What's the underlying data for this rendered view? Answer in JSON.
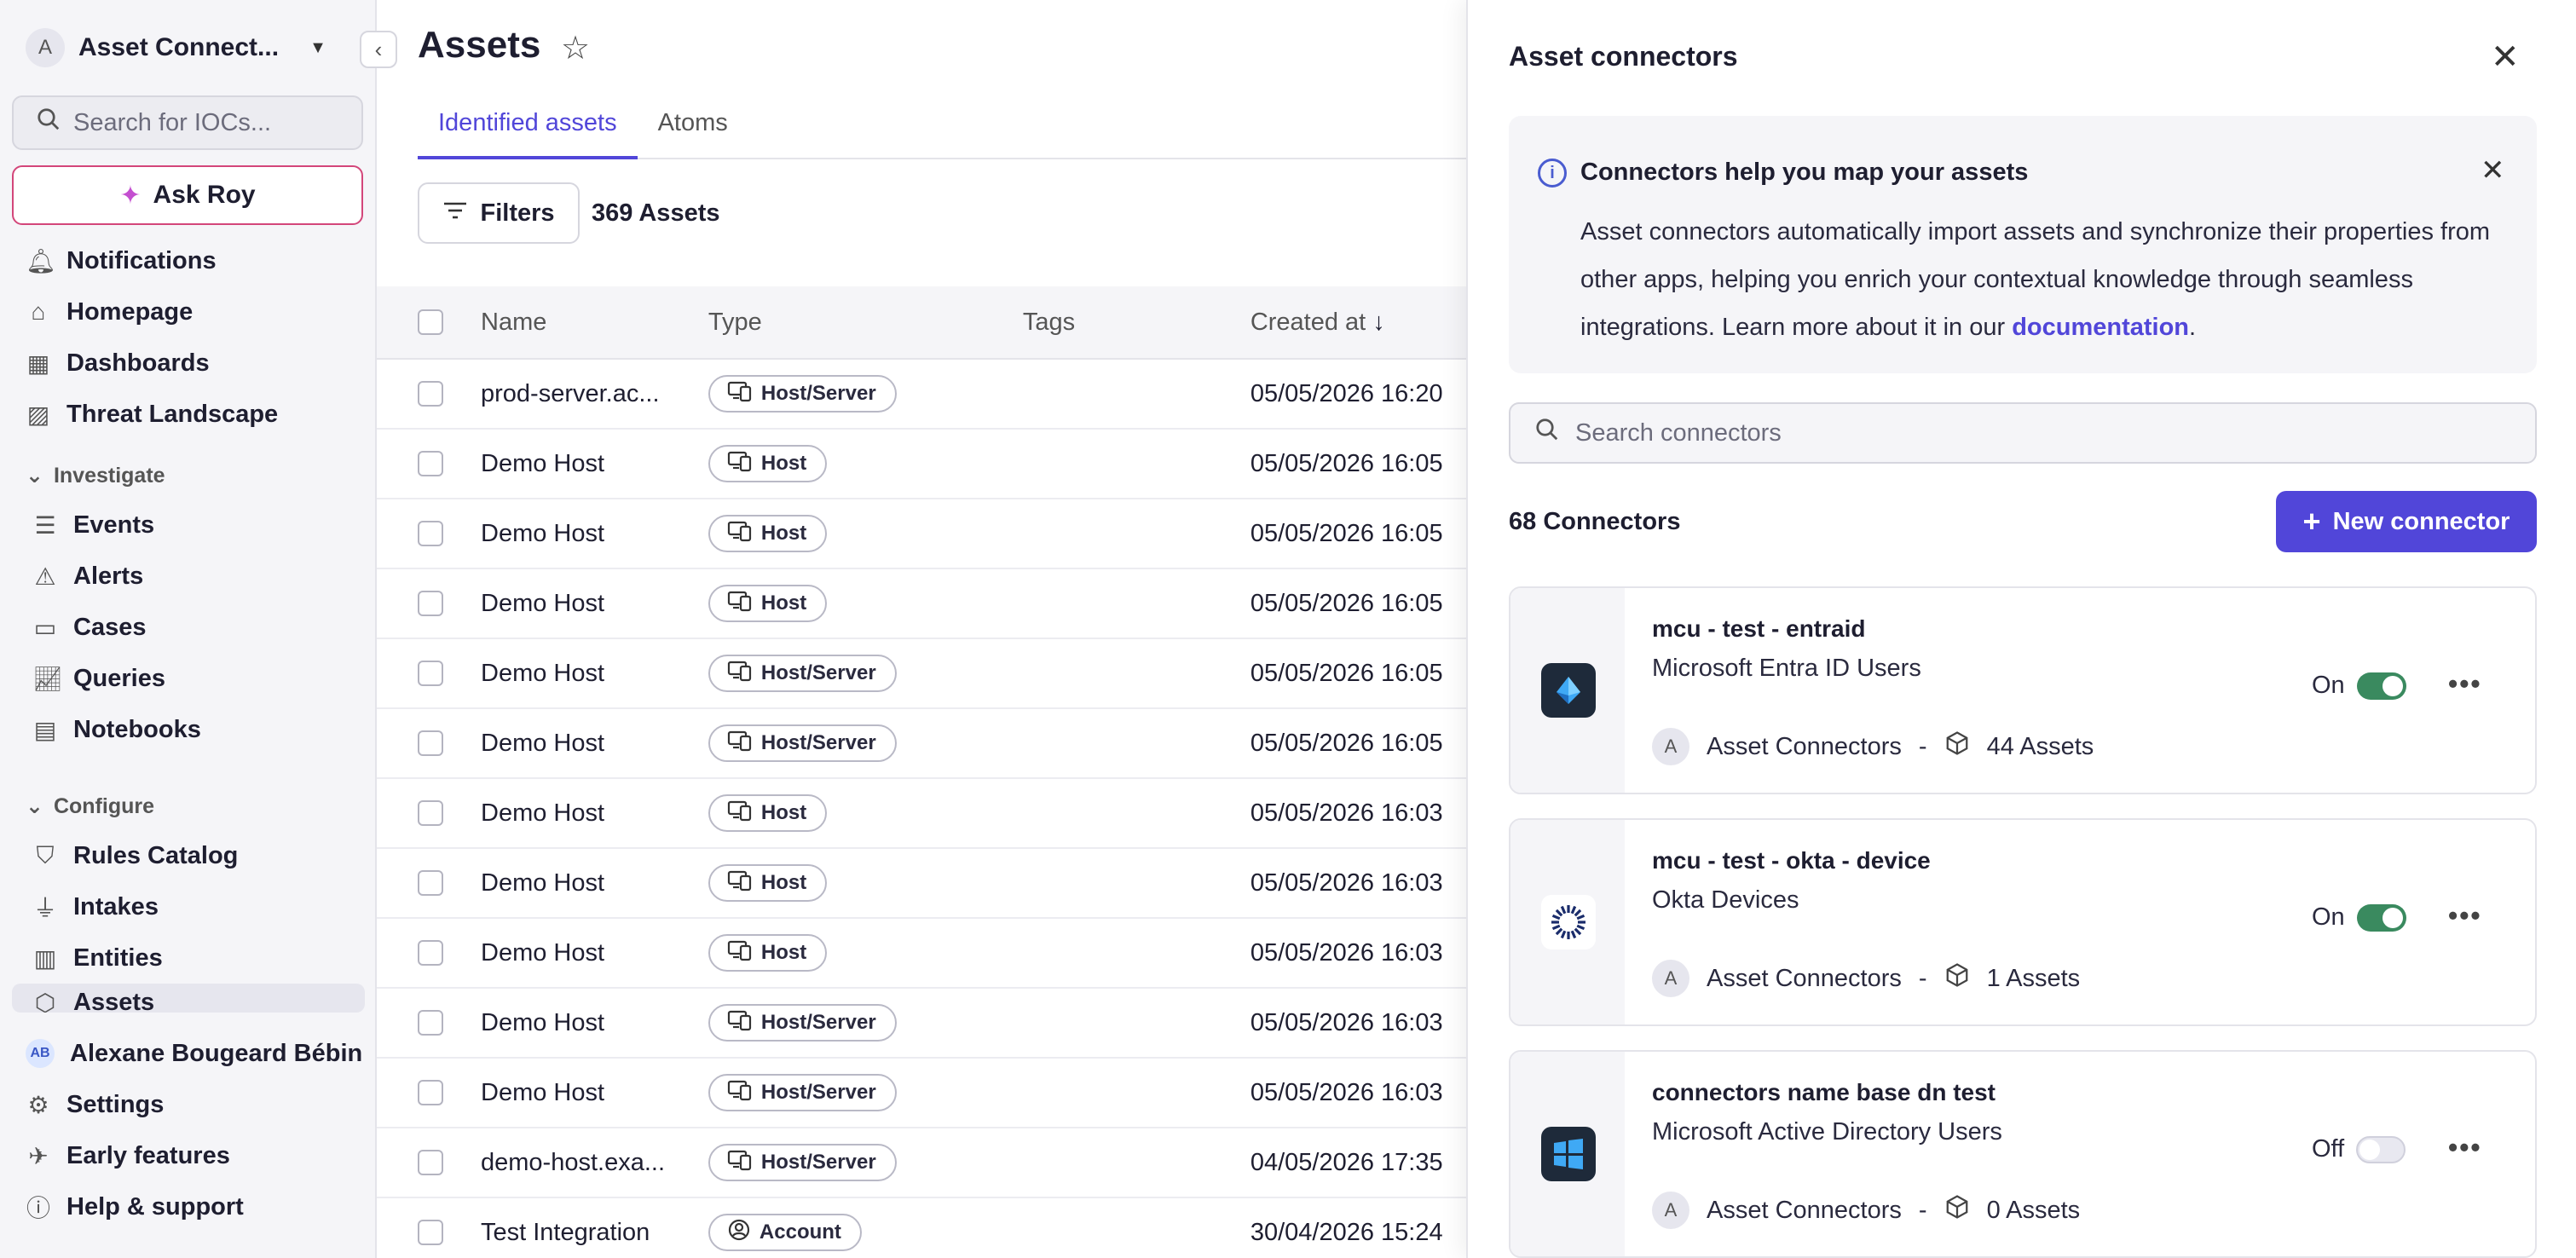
{
  "sidebar": {
    "workspace_initial": "A",
    "workspace_name": "Asset Connect...",
    "search_placeholder": "Search for IOCs...",
    "ask_label": "Ask Roy",
    "top_items": [
      {
        "label": "Notifications",
        "icon": "bell-icon"
      },
      {
        "label": "Homepage",
        "icon": "home-icon"
      },
      {
        "label": "Dashboards",
        "icon": "dashboard-icon"
      },
      {
        "label": "Threat Landscape",
        "icon": "image-icon"
      }
    ],
    "investigate_label": "Investigate",
    "investigate_items": [
      {
        "label": "Events",
        "icon": "list-icon"
      },
      {
        "label": "Alerts",
        "icon": "warning-icon"
      },
      {
        "label": "Cases",
        "icon": "folder-icon"
      },
      {
        "label": "Queries",
        "icon": "chart-icon"
      },
      {
        "label": "Notebooks",
        "icon": "notebook-icon"
      }
    ],
    "configure_label": "Configure",
    "configure_items": [
      {
        "label": "Rules Catalog",
        "icon": "shield-icon"
      },
      {
        "label": "Intakes",
        "icon": "plug-icon"
      },
      {
        "label": "Entities",
        "icon": "building-icon"
      },
      {
        "label": "Assets",
        "icon": "cube-icon"
      }
    ],
    "user_initials": "AB",
    "user_name": "Alexane Bougeard Bébin",
    "bottom_items": [
      {
        "label": "Settings",
        "icon": "gear-icon"
      },
      {
        "label": "Early features",
        "icon": "rocket-icon"
      },
      {
        "label": "Help & support",
        "icon": "info-icon"
      }
    ]
  },
  "main": {
    "title": "Assets",
    "tabs": [
      "Identified assets",
      "Atoms"
    ],
    "filters_label": "Filters",
    "asset_count": "369 Assets",
    "columns": [
      "Name",
      "Type",
      "Tags",
      "Created at"
    ],
    "rows": [
      {
        "name": "prod-server.ac...",
        "type": "Host/Server",
        "created": "05/05/2026 16:20"
      },
      {
        "name": "Demo Host",
        "type": "Host",
        "created": "05/05/2026 16:05"
      },
      {
        "name": "Demo Host",
        "type": "Host",
        "created": "05/05/2026 16:05"
      },
      {
        "name": "Demo Host",
        "type": "Host",
        "created": "05/05/2026 16:05"
      },
      {
        "name": "Demo Host",
        "type": "Host/Server",
        "created": "05/05/2026 16:05"
      },
      {
        "name": "Demo Host",
        "type": "Host/Server",
        "created": "05/05/2026 16:05"
      },
      {
        "name": "Demo Host",
        "type": "Host",
        "created": "05/05/2026 16:03"
      },
      {
        "name": "Demo Host",
        "type": "Host",
        "created": "05/05/2026 16:03"
      },
      {
        "name": "Demo Host",
        "type": "Host",
        "created": "05/05/2026 16:03"
      },
      {
        "name": "Demo Host",
        "type": "Host/Server",
        "created": "05/05/2026 16:03"
      },
      {
        "name": "Demo Host",
        "type": "Host/Server",
        "created": "05/05/2026 16:03"
      },
      {
        "name": "demo-host.exa...",
        "type": "Host/Server",
        "created": "04/05/2026 17:35"
      },
      {
        "name": "Test Integration",
        "type": "Account",
        "created": "30/04/2026 15:24"
      }
    ]
  },
  "panel": {
    "title": "Asset connectors",
    "info_title": "Connectors help you map your assets",
    "info_text_before": "Asset connectors automatically import assets and synchronize their properties from other apps, helping you enrich your contextual knowledge through seamless integrations. Learn more about it in our ",
    "info_link": "documentation",
    "info_text_after": ".",
    "search_placeholder": "Search connectors",
    "count": "68 Connectors",
    "new_label": "New connector",
    "connectors": [
      {
        "name": "mcu - test - entraid",
        "type": "Microsoft Entra ID Users",
        "owner_initial": "A",
        "owner": "Asset Connectors",
        "separator": "-",
        "assets": "44 Assets",
        "status": "On",
        "enabled": true,
        "logo": "entra-logo-icon"
      },
      {
        "name": "mcu - test - okta - device",
        "type": "Okta Devices",
        "owner_initial": "A",
        "owner": "Asset Connectors",
        "separator": "-",
        "assets": "1 Assets",
        "status": "On",
        "enabled": true,
        "logo": "okta-logo-icon"
      },
      {
        "name": "connectors name base dn test",
        "type": "Microsoft Active Directory Users",
        "owner_initial": "A",
        "owner": "Asset Connectors",
        "separator": "-",
        "assets": "0 Assets",
        "status": "Off",
        "enabled": false,
        "logo": "windows-logo-icon"
      }
    ]
  },
  "colors": {
    "accent": "#5146d9",
    "toggle_on": "#3a8a5f",
    "ask_border": "#d3467a"
  }
}
